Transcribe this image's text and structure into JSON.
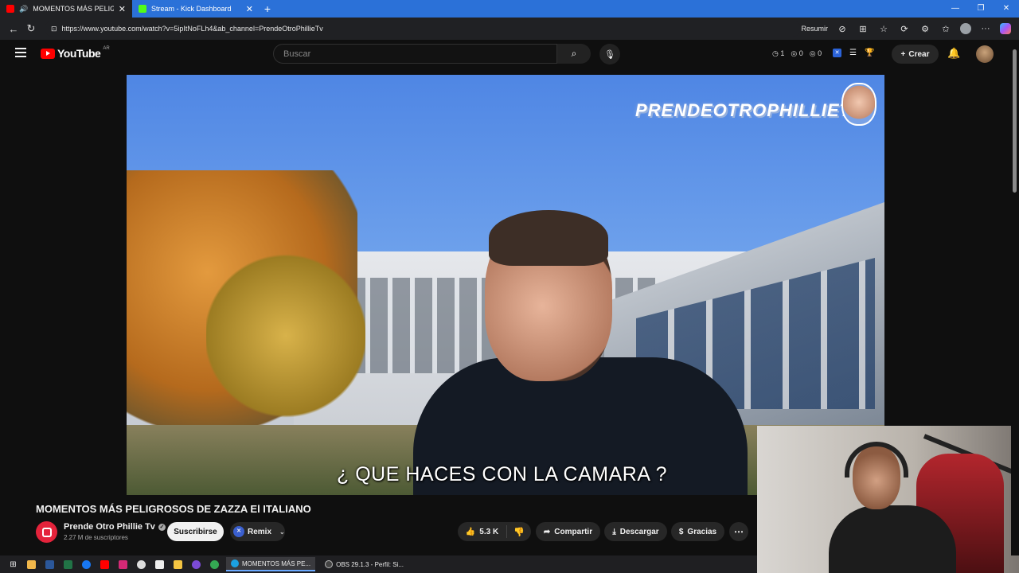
{
  "browser": {
    "tabs": [
      {
        "title": "MOMENTOS MÁS PELIGROSOS",
        "active": true
      },
      {
        "title": "Stream - Kick Dashboard",
        "active": false
      }
    ],
    "url": "https://www.youtube.com/watch?v=5ipItNoFLh4&ab_channel=PrendeOtroPhillieTv",
    "summarize_label": "Resumir"
  },
  "youtube": {
    "logo_text": "YouTube",
    "country_code": "AR",
    "search_placeholder": "Buscar",
    "counters": [
      "1",
      "0",
      "0"
    ],
    "create_label": "Crear"
  },
  "video": {
    "watermark": "PRENDEOTROPHILLIET",
    "subtitle": "¿ QUE HACES CON LA CAMARA ?",
    "title": "MOMENTOS MÁS PELIGROSOS DE ZAZZA El ITALIANO"
  },
  "channel": {
    "name": "Prende Otro Phillie Tv",
    "subscribers": "2.27 M de suscriptores",
    "subscribe_label": "Suscribirse",
    "remix_label": "Remix"
  },
  "actions": {
    "likes": "5.3 K",
    "share": "Compartir",
    "download": "Descargar",
    "thanks": "Gracias"
  },
  "taskbar": {
    "apps": [
      "MOMENTOS MÁS PE...",
      "OBS 29.1.3 - Perfil: Si..."
    ]
  },
  "colors": {
    "youtube_red": "#ff0000",
    "browser_accent": "#2b71d8",
    "dark_bg": "#0f0f0f",
    "chip_bg": "#272727"
  }
}
